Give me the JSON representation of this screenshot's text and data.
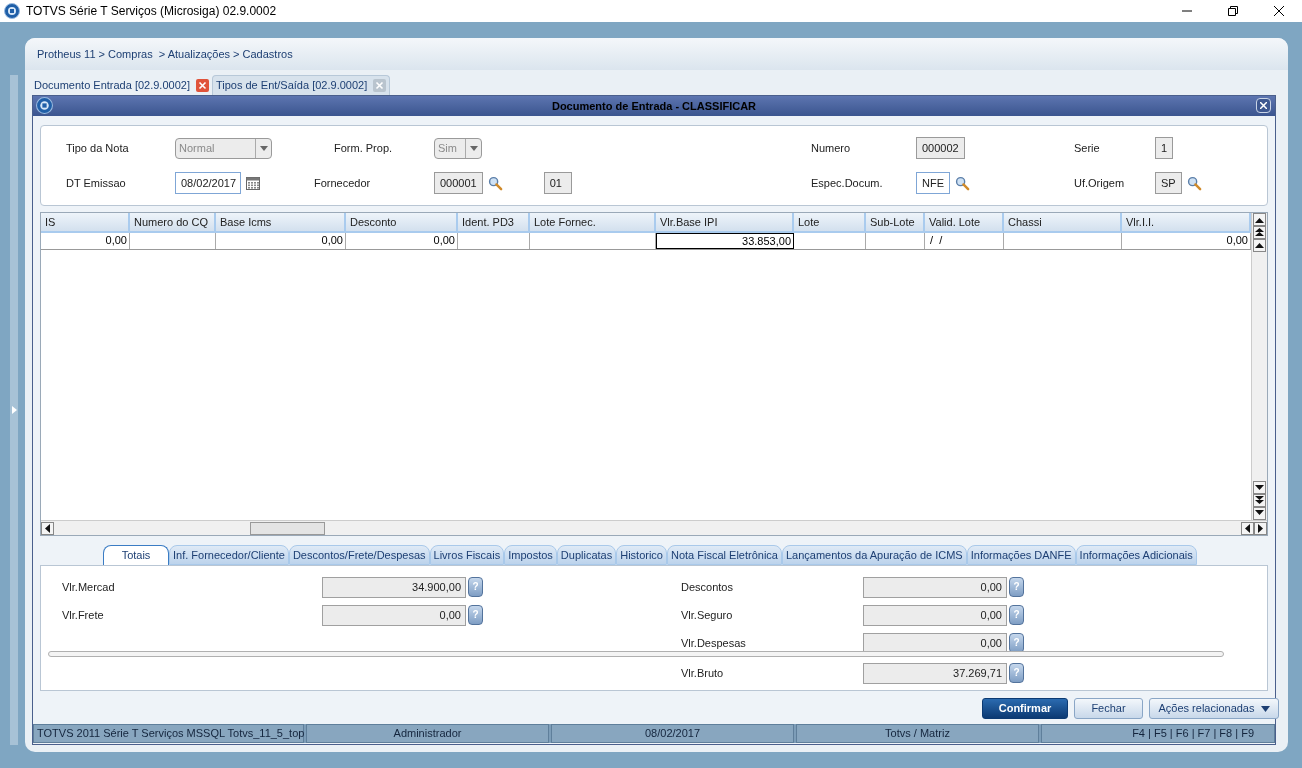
{
  "window": {
    "title": "TOTVS Série T Serviços (Microsiga) 02.9.0002"
  },
  "breadcrumb": "Protheus 11 > Compras  > Atualizações > Cadastros",
  "tabs": [
    {
      "label": "Documento Entrada [02.9.0002]",
      "selected": true
    },
    {
      "label": "Tipos de Ent/Saída [02.9.0002]",
      "selected": false
    }
  ],
  "dialog": {
    "title": "Documento de Entrada - CLASSIFICAR"
  },
  "form": {
    "rows": [
      [
        {
          "label": "Tipo da Nota",
          "value": "Normal",
          "kind": "select",
          "editable": false
        },
        {
          "label": "Form. Prop.",
          "value": "Sim",
          "kind": "select",
          "editable": false
        },
        {
          "label": "Numero",
          "value": "000002",
          "kind": "text",
          "editable": false
        },
        {
          "label": "Serie",
          "value": "1",
          "kind": "text",
          "editable": false
        }
      ],
      [
        {
          "label": "DT Emissao",
          "value": "08/02/2017",
          "kind": "date",
          "editable": true
        },
        {
          "label": "Fornecedor",
          "value": "000001",
          "kind": "lookup",
          "editable": false,
          "extra": "01"
        },
        {
          "label": "Espec.Docum.",
          "value": "NFE",
          "kind": "lookup",
          "editable": true
        },
        {
          "label": "Uf.Origem",
          "value": "SP",
          "kind": "lookup",
          "editable": false
        }
      ]
    ]
  },
  "table": {
    "columns": [
      "IS",
      "Numero do CQ",
      "Base Icms",
      "Desconto",
      "Ident. PD3",
      "Lote Fornec.",
      "Vlr.Base IPI",
      "Lote",
      "Sub-Lote",
      "Valid. Lote",
      "Chassi",
      "Vlr.I.I."
    ],
    "rows": [
      {
        "cells": [
          {
            "text": "0,00",
            "focused": false
          },
          {
            "focused": false
          },
          {
            "text": "0,00",
            "focused": false
          },
          {
            "text": "0,00",
            "focused": false
          },
          {
            "focused": false
          },
          {
            "focused": false
          },
          {
            "text": "33.853,00",
            "focused": true
          },
          {
            "focused": false
          },
          {
            "focused": false
          },
          {
            "text": " /  /",
            "focused": false
          },
          {
            "focused": false
          },
          {
            "text": "0,00",
            "focused": false
          }
        ]
      }
    ]
  },
  "folders": [
    {
      "label": "Totais",
      "selected": true
    },
    {
      "label": "Inf. Fornecedor/Cliente",
      "selected": false
    },
    {
      "label": "Descontos/Frete/Despesas",
      "selected": false
    },
    {
      "label": "Livros Fiscais",
      "selected": false
    },
    {
      "label": "Impostos",
      "selected": false
    },
    {
      "label": "Duplicatas",
      "selected": false
    },
    {
      "label": "Historico",
      "selected": false
    },
    {
      "label": "Nota Fiscal Eletrônica",
      "selected": false
    },
    {
      "label": "Lançamentos da Apuração de ICMS",
      "selected": false
    },
    {
      "label": "Informações DANFE",
      "selected": false
    },
    {
      "label": "Informações Adicionais",
      "selected": false
    }
  ],
  "totals": {
    "left": [
      {
        "label": "Vlr.Mercad",
        "value": "34.900,00",
        "help": "?"
      },
      {
        "label": "Vlr.Frete",
        "value": "0,00",
        "help": "?"
      }
    ],
    "right": [
      {
        "label": "Descontos",
        "value": "0,00",
        "help": "?"
      },
      {
        "label": "Vlr.Seguro",
        "value": "0,00",
        "help": "?"
      },
      {
        "label": "Vlr.Despesas",
        "value": "0,00",
        "help": "?"
      }
    ],
    "total": {
      "label": "Vlr.Bruto",
      "value": "37.269,71",
      "help": "?"
    }
  },
  "buttons": [
    {
      "label": "Confirmar",
      "kind": "primary"
    },
    {
      "label": "Fechar",
      "kind": "default"
    },
    {
      "label": "Ações relacionadas",
      "kind": "menu"
    }
  ],
  "status_bar": [
    "TOTVS 2011 Série T Serviços MSSQL Totvs_11_5_top",
    "Administrador",
    "08/02/2017",
    "Totvs / Matriz",
    "F4 | F5 | F6 | F7 | F8 | F9"
  ]
}
